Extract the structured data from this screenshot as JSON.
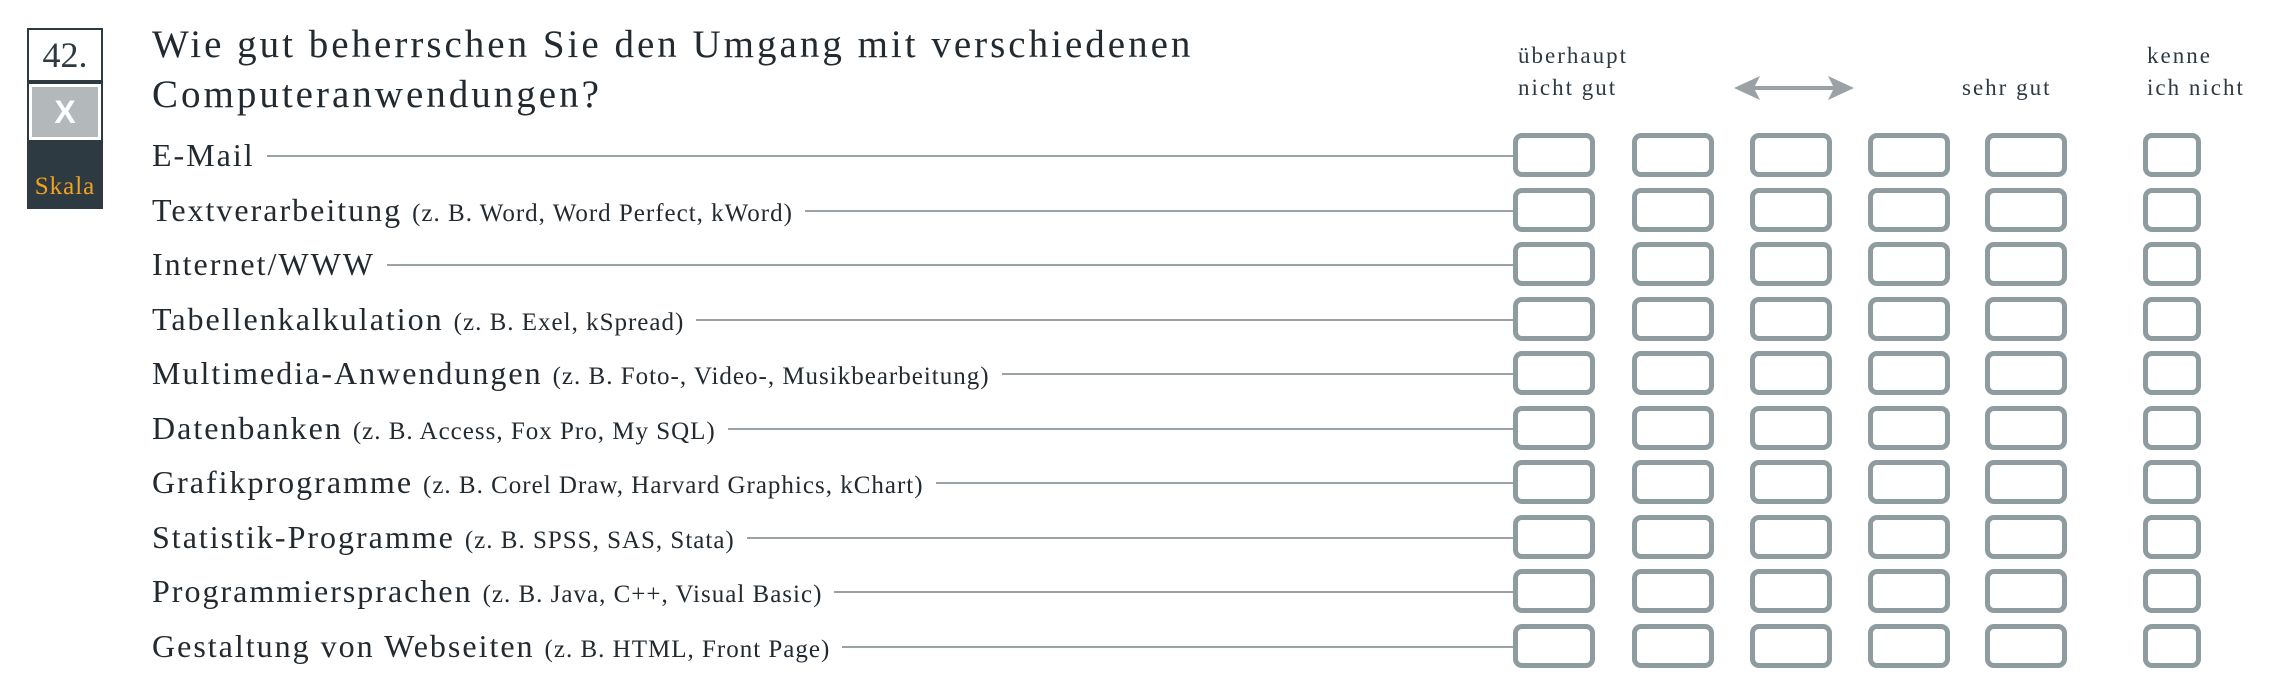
{
  "question": {
    "number": "42.",
    "flag": "X",
    "scale_label": "Skala",
    "text_line1": "Wie gut beherrschen Sie den Umgang mit verschiedenen",
    "text_line2": "Computeranwendungen?"
  },
  "scale": {
    "low_line1": "überhaupt",
    "low_line2": "nicht gut",
    "high": "sehr gut",
    "unknown_line1": "kenne",
    "unknown_line2": "ich nicht",
    "arrow_icon": "double-arrow-icon",
    "points": 5
  },
  "items": [
    {
      "label": "E-Mail",
      "example": ""
    },
    {
      "label": "Textverarbeitung",
      "example": "(z. B. Word, Word Perfect, kWord)"
    },
    {
      "label": "Internet/WWW",
      "example": ""
    },
    {
      "label": "Tabellenkalkulation",
      "example": "(z. B. Exel, kSpread)"
    },
    {
      "label": "Multimedia-Anwendungen",
      "example": "(z. B. Foto-, Video-, Musikbearbeitung)"
    },
    {
      "label": "Datenbanken",
      "example": "(z. B. Access, Fox Pro, My SQL)"
    },
    {
      "label": "Grafikprogramme",
      "example": "(z. B. Corel Draw, Harvard Graphics, kChart)"
    },
    {
      "label": "Statistik-Programme",
      "example": "(z. B. SPSS, SAS, Stata)"
    },
    {
      "label": "Programmiersprachen",
      "example": "(z. B. Java, C++, Visual Basic)"
    },
    {
      "label": "Gestaltung von Webseiten",
      "example": "(z. B. HTML, Front Page)"
    }
  ],
  "colors": {
    "box_dark": "#2e3a42",
    "box_grey": "#b3b9bb",
    "skala_orange": "#f4a21c",
    "checkbox_border": "#8e9c9f"
  }
}
